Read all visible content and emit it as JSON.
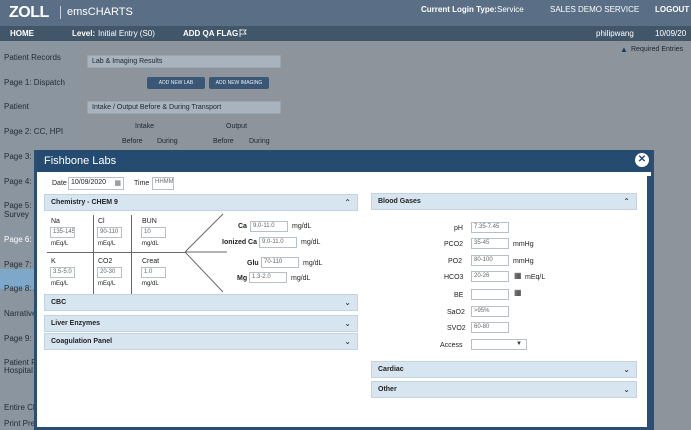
{
  "header": {
    "logo": "ZOLL",
    "product": "emsCHARTS",
    "login_type_label": "Current Login Type:",
    "login_type_value": "Service",
    "organization": "SALES DEMO SERVICE",
    "logout": "LOGOUT"
  },
  "navbar": {
    "home": "HOME",
    "level_label": "Level:",
    "level_value": "Initial Entry (S0)",
    "add_qa_flag": "ADD QA FLAG",
    "flag_icon": "flag-icon",
    "user": "philipwang",
    "date": "10/09/20"
  },
  "sidebar": {
    "items": [
      {
        "label": "Patient Records"
      },
      {
        "label": "Page 1: Dispatch"
      },
      {
        "label": "Patient"
      },
      {
        "label": "Page 2: CC, HPI"
      },
      {
        "label": "Page 3: N"
      },
      {
        "label": "Page 4: R"
      },
      {
        "label": "Page 5: S"
      },
      {
        "label": "Survey"
      },
      {
        "label": "Page 6: L"
      },
      {
        "label": "Page 7: M"
      },
      {
        "label": "Page 8: A"
      },
      {
        "label": "Narrative"
      },
      {
        "label": "Page 9: M"
      },
      {
        "label": "Patient Fe"
      },
      {
        "label": "Hospital T"
      },
      {
        "label": "Entire Ch"
      },
      {
        "label": "Print Prev"
      }
    ],
    "active_index": 8
  },
  "main": {
    "required_entries": "Required Entries",
    "lab_section": "Lab & Imaging Results",
    "add_new_lab": "ADD NEW LAB",
    "add_new_imaging": "ADD NEW IMAGING",
    "intake_section": "Intake / Output Before & During Transport",
    "intake": "Intake",
    "output": "Output",
    "before_1": "Before",
    "during_1": "During",
    "before_2": "Before",
    "during_2": "During"
  },
  "modal": {
    "title": "Fishbone Labs",
    "close_icon": "close-icon",
    "date_label": "Date",
    "date_value": "10/09/2020",
    "calendar_icon": "calendar-icon",
    "time_label": "Time",
    "time_placeholder": "HHMM",
    "chem9": {
      "title": "Chemistry - CHEM 9",
      "na_label": "Na",
      "na_range": "135-145",
      "na_unit": "mEq/L",
      "cl_label": "Cl",
      "cl_range": "90-110",
      "cl_unit": "mEq/L",
      "bun_label": "BUN",
      "bun_range": "10",
      "bun_unit": "mg/dL",
      "k_label": "K",
      "k_range": "3.5-5.0",
      "k_unit": "mEq/L",
      "co2_label": "CO2",
      "co2_range": "20-30",
      "co2_unit": "mEq/L",
      "creat_label": "Creat",
      "creat_range": "1.0",
      "creat_unit": "mg/dL",
      "ca_label": "Ca",
      "ca_range": "9.0-11.0",
      "ca_unit": "mg/dL",
      "ica_label": "Ionized Ca",
      "ica_range": "9.0-11.0",
      "ica_unit": "mg/dL",
      "glu_label": "Glu",
      "glu_range": "70-110",
      "glu_unit": "mg/dL",
      "mg_label": "Mg",
      "mg_range": "1.3-2.0",
      "mg_unit": "mg/dL"
    },
    "collapsed_left": [
      "CBC",
      "Liver Enzymes",
      "Coagulation Panel"
    ],
    "blood_gases": {
      "title": "Blood Gases",
      "ph_label": "pH",
      "ph_range": "7.35-7.45",
      "pco2_label": "PCO2",
      "pco2_range": "35-45",
      "pco2_unit": "mmHg",
      "po2_label": "PO2",
      "po2_range": "80-100",
      "po2_unit": "mmHg",
      "hco3_label": "HCO3",
      "hco3_range": "20-26",
      "hco3_unit": "mEq/L",
      "be_label": "BE",
      "sao2_label": "SaO2",
      "sao2_range": ">95%",
      "svo2_label": "SVO2",
      "svo2_range": "60-80",
      "access_label": "Access"
    },
    "collapsed_right": [
      "Cardiac",
      "Other"
    ]
  }
}
